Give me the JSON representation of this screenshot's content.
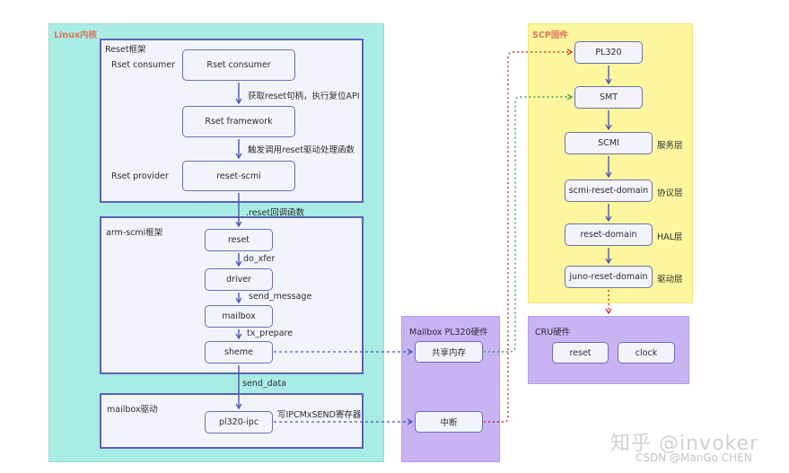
{
  "regions": {
    "linux": {
      "title": "Linux内核"
    },
    "reset_framework": {
      "title": "Reset框架"
    },
    "arm_scmi": {
      "title": "arm-scmi框架"
    },
    "mailbox_driver": {
      "title": "mailbox驱动"
    },
    "mailbox_hw": {
      "title": "Mailbox PL320硬件"
    },
    "scp": {
      "title": "SCP固件"
    },
    "cru": {
      "title": "CRU硬件"
    }
  },
  "reset_framework": {
    "side_labels": {
      "consumer": "Rset consumer",
      "provider": "Rset provider"
    },
    "boxes": {
      "consumer": "Rset consumer",
      "framework": "Rset framework",
      "provider": "reset-scmi"
    },
    "edges": {
      "get_handle": "获取reset句柄，执行复位API",
      "trigger": "触发调用reset驱动处理函数"
    }
  },
  "between": {
    "reset_callback": ".reset回调函数",
    "send_data": "send_data"
  },
  "arm_scmi": {
    "boxes": {
      "reset": "reset",
      "driver": "driver",
      "mailbox": "mailbox",
      "sheme": "sheme"
    },
    "edges": {
      "do_xfer": "do_xfer",
      "send_message": "send_message",
      "tx_prepare": "tx_prepare"
    }
  },
  "mailbox_driver": {
    "boxes": {
      "pl320": "pl320-ipc"
    },
    "edges": {
      "write_reg": "写IPCMxSEND寄存器"
    }
  },
  "mailbox_hw": {
    "boxes": {
      "shared_mem": "共享内存",
      "interrupt": "中断"
    }
  },
  "scp": {
    "boxes": {
      "pl320": "PL320",
      "smt": "SMT",
      "scmi": "SCMI",
      "scmi_reset_domain": "scmi-reset-domain",
      "reset_domain": "reset-domain",
      "juno_reset_domain": "juno-reset-domain"
    },
    "layers": {
      "service": "服务层",
      "protocol": "协议层",
      "hal": "HAL层",
      "driver": "驱动层"
    }
  },
  "cru": {
    "boxes": {
      "reset": "reset",
      "clock": "clock"
    }
  },
  "watermark": {
    "line1": "知乎 @invoker",
    "line2": "CSDN @ManGo CHEN"
  },
  "colors": {
    "linux_bg": "#a9ece4",
    "sub_bg": "#f3f4fb",
    "sub_border": "#5a63b8",
    "mailbox_bg": "#c9b3f3",
    "scp_bg": "#fcf79e",
    "region_title": "#e0705e",
    "arrow": "#4a55b0",
    "red_link": "#c8322a",
    "green_link": "#3a9a5a"
  }
}
